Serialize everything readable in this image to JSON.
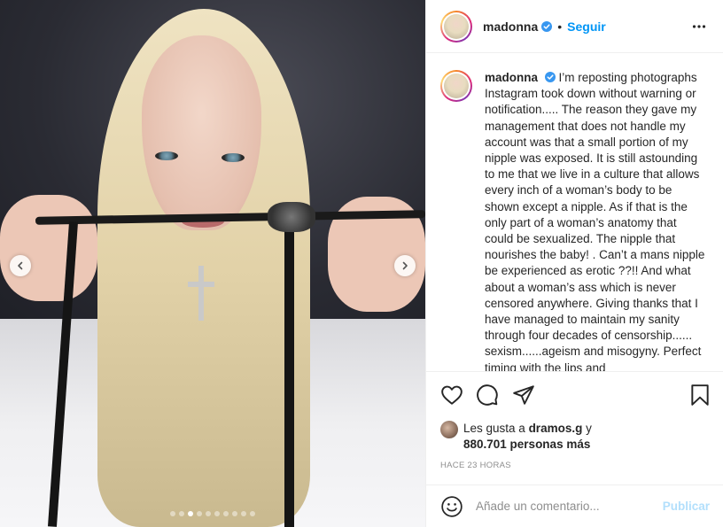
{
  "post": {
    "username": "madonna",
    "follow_label": "Seguir",
    "bullet": "•",
    "caption_username": "madonna",
    "caption": "I’m reposting photographs Instagram took down without warning or notification..... The reason they gave my management that does not handle my account was that a small portion of my nipple was exposed. It is still astounding to me that we live in a culture that allows every inch of a woman’s body to be shown except a nipple. As if that is the only part of a woman’s anatomy that could be sexualized. The nipple that nourishes the baby! . Can’t a mans nipple be experienced as erotic ??!! And what about a woman’s ass which is never censored anywhere. Giving thanks that I have managed to maintain my sanity through four decades of censorship...... sexism......ageism and misogyny. Perfect timing with the lips and",
    "likes_prefix": "Les gusta a ",
    "likes_user": "dramos.g",
    "likes_middle": " y",
    "likes_count": "880.701 personas más",
    "timestamp": "HACE 23 HORAS",
    "carousel_index": 3,
    "carousel_total": 10
  },
  "comment": {
    "placeholder": "Añade un comentario...",
    "publish_label": "Publicar"
  },
  "icons": {
    "verified": "verified-badge-icon",
    "more": "more-options-icon",
    "like": "heart-icon",
    "comment": "comment-bubble-icon",
    "share": "paper-plane-icon",
    "save": "bookmark-icon",
    "emoji": "emoji-icon",
    "prev": "chevron-left-icon",
    "next": "chevron-right-icon"
  },
  "colors": {
    "link_blue": "#0095f6",
    "verified_blue": "#3897f0",
    "publish_disabled": "#b2dffc",
    "secondary_text": "#8e8e8e"
  }
}
